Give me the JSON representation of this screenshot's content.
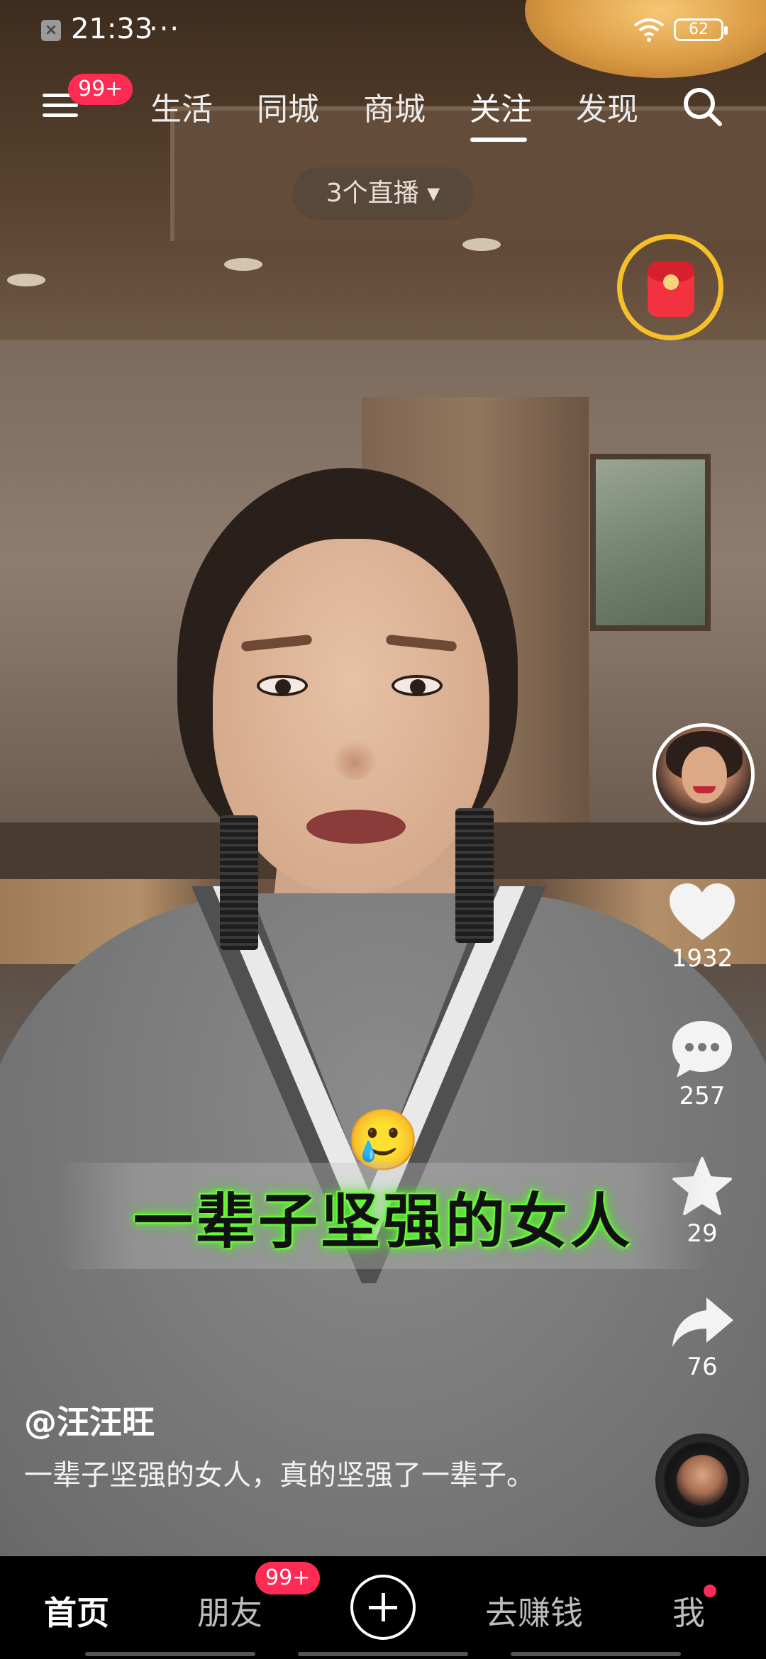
{
  "status_bar": {
    "time": "21:33",
    "dots": "···",
    "battery": "62"
  },
  "top_nav": {
    "menu_badge": "99+",
    "tabs": [
      {
        "label": "生活",
        "active": false
      },
      {
        "label": "同城",
        "active": false
      },
      {
        "label": "商城",
        "active": false
      },
      {
        "label": "关注",
        "active": true
      },
      {
        "label": "发现",
        "active": false
      }
    ]
  },
  "live_pill": {
    "label": "3个直播 ▾"
  },
  "actions": {
    "likes": "1932",
    "comments": "257",
    "favorites": "29",
    "shares": "76"
  },
  "video": {
    "emoji": "🥲",
    "subtitle": "一辈子坚强的女人",
    "author": "@汪汪旺",
    "description": "一辈子坚强的女人，真的坚强了一辈子。"
  },
  "bottom_nav": {
    "items": [
      {
        "label": "首页",
        "active": true
      },
      {
        "label": "朋友",
        "active": false
      },
      {
        "label": "去赚钱",
        "active": false
      },
      {
        "label": "我",
        "active": false
      }
    ],
    "friends_badge": "99+"
  },
  "colors": {
    "accent": "#fe2c55",
    "ring": "#f5c02a",
    "subtitle_glow": "#5cff2a"
  }
}
